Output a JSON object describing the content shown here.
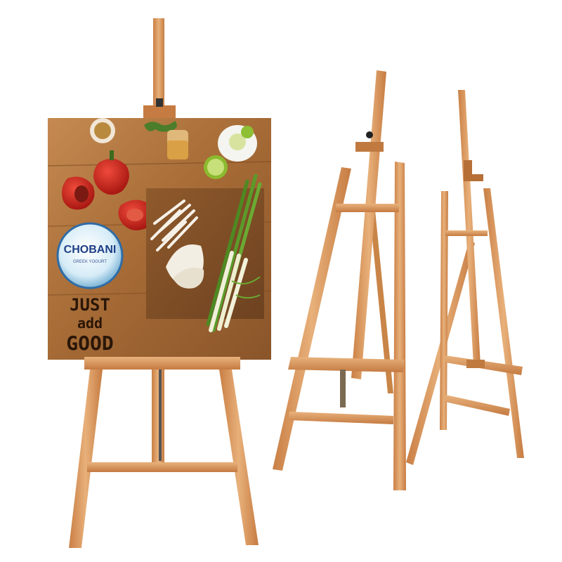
{
  "poster": {
    "brand": "CHOBANI",
    "brand_subtitle": "GREEK YOGURT",
    "slogan_line1": "JUST",
    "slogan_line2": "add",
    "slogan_line3": "GOOD"
  },
  "colors": {
    "background": "#ffffff",
    "wood_light": "#e3a86b",
    "wood_mid": "#d0894e",
    "wood_dark": "#a8632f",
    "tabletop": "#b6773f",
    "pepper_red": "#c9221b",
    "lime": "#9cc63a"
  },
  "objects": {
    "easels": [
      "easel-with-poster",
      "easel-front-view",
      "easel-side-view"
    ]
  }
}
